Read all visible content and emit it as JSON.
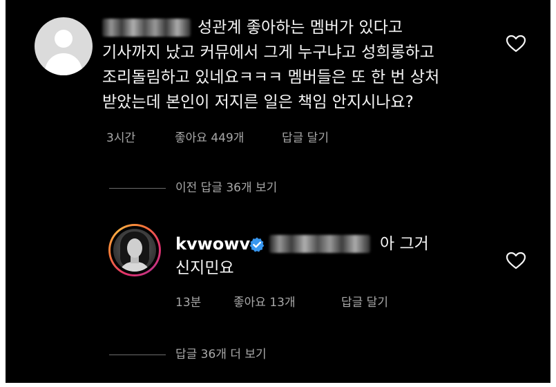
{
  "comment": {
    "avatar_icon": "default-avatar-icon",
    "lines": [
      "성관계 좋아하는 멤버가 있다고",
      "기사까지 났고 커뮤에서 그게 누구냐고 성희롱하고",
      "조리돌림하고 있네요ㅋㅋㅋ 멤버들은 또 한 번 상처",
      "받았는데 본인이 저지른 일은 책임 안지시나요?"
    ],
    "time": "3시간",
    "likes": "좋아요 449개",
    "reply_action": "답글 달기",
    "like_icon": "heart-outline-icon"
  },
  "view_previous": "이전 답글 36개 보기",
  "reply": {
    "username": "kvwowv",
    "verified_icon": "verified-badge-icon",
    "line1": "아 그거",
    "line2": "신지민요",
    "time": "13분",
    "likes": "좋아요 13개",
    "reply_action": "답글 달기",
    "like_icon": "heart-outline-icon"
  },
  "view_more": "답글 36개 더 보기",
  "colors": {
    "background": "#000000",
    "primary_text": "#f5f5f5",
    "secondary_text": "#a8a8a8",
    "verified": "#3897f0",
    "avatar_ring": "#e1306c"
  }
}
